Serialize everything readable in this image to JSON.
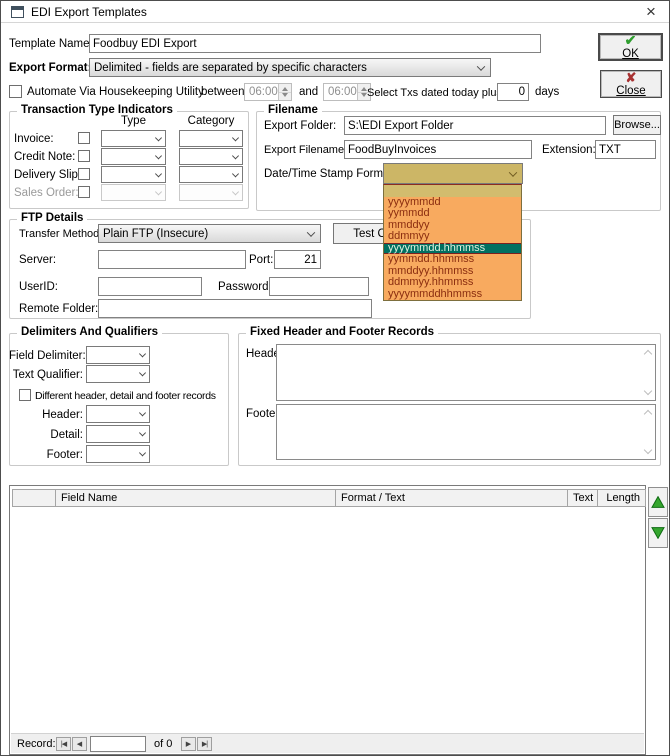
{
  "window": {
    "title": "EDI Export Templates"
  },
  "fields": {
    "template_name": {
      "label": "Template Name:",
      "value": "Foodbuy EDI Export"
    },
    "export_format": {
      "label": "Export Format:",
      "value": "Delimited - fields are separated by specific characters"
    },
    "automate": {
      "label": "Automate Via Housekeeping Utility",
      "between_label": "between",
      "between_value": "06:00",
      "and_label": "and",
      "and_value": "06:00",
      "select_label": "Select Txs dated today plus",
      "days_value": "0",
      "days_label": "days"
    }
  },
  "buttons": {
    "ok": "OK",
    "close": "Close",
    "browse": "Browse...",
    "test_connection": "Test Connection"
  },
  "transaction_types": {
    "title": "Transaction Type Indicators",
    "col_type": "Type",
    "col_category": "Category",
    "rows": [
      {
        "label": "Invoice:"
      },
      {
        "label": "Credit Note:"
      },
      {
        "label": "Delivery Slip:"
      },
      {
        "label": "Sales Order:"
      }
    ]
  },
  "filename": {
    "title": "Filename",
    "export_folder": {
      "label": "Export Folder:",
      "value": "S:\\EDI Export Folder"
    },
    "export_filename": {
      "label": "Export Filename:",
      "value": "FoodBuyInvoices"
    },
    "extension": {
      "label": "Extension:",
      "value": "TXT"
    },
    "datetime": {
      "label": "Date/Time Stamp Format:",
      "value": "",
      "options": [
        "",
        "yyyymmdd",
        "yymmdd",
        "mmddyy",
        "ddmmyy",
        "yyyymmdd.hhmmss",
        "yymmdd.hhmmss",
        "mmddyy.hhmmss",
        "ddmmyy.hhmmss",
        "yyyymmddhhmmss"
      ],
      "selected": "yyyymmdd.hhmmss"
    }
  },
  "ftp": {
    "title": "FTP Details",
    "transfer_method": {
      "label": "Transfer Method:",
      "value": "Plain FTP (Insecure)"
    },
    "server": {
      "label": "Server:",
      "value": ""
    },
    "port": {
      "label": "Port:",
      "value": "21"
    },
    "userid": {
      "label": "UserID:",
      "value": ""
    },
    "password": {
      "label": "Password:",
      "value": ""
    },
    "remote_folder": {
      "label": "Remote Folder:",
      "value": ""
    }
  },
  "delimiters": {
    "title": "Delimiters And Qualifiers",
    "field_delimiter_label": "Field Delimiter:",
    "text_qualifier_label": "Text Qualifier:",
    "different_records_label": "Different header, detail and footer records",
    "header_label": "Header:",
    "detail_label": "Detail:",
    "footer_label": "Footer:"
  },
  "fixed_records": {
    "title": "Fixed Header and Footer Records",
    "header_label": "Header:",
    "footer_label": "Footer:"
  },
  "grid": {
    "columns": [
      "",
      "Field Name",
      "Format / Text",
      "Text",
      "Length"
    ],
    "rows": []
  },
  "record_bar": {
    "label": "Record:",
    "of_label": "of 0",
    "value": ""
  },
  "colors": {
    "dropdown_orange": "#f8aa5f",
    "combo_tan": "#ccb666",
    "selected_teal": "#007061",
    "option_text": "#8b2e10",
    "check_green": "#2f9e2f",
    "x_red": "#a83232",
    "arrow_green": "#35a62e"
  }
}
